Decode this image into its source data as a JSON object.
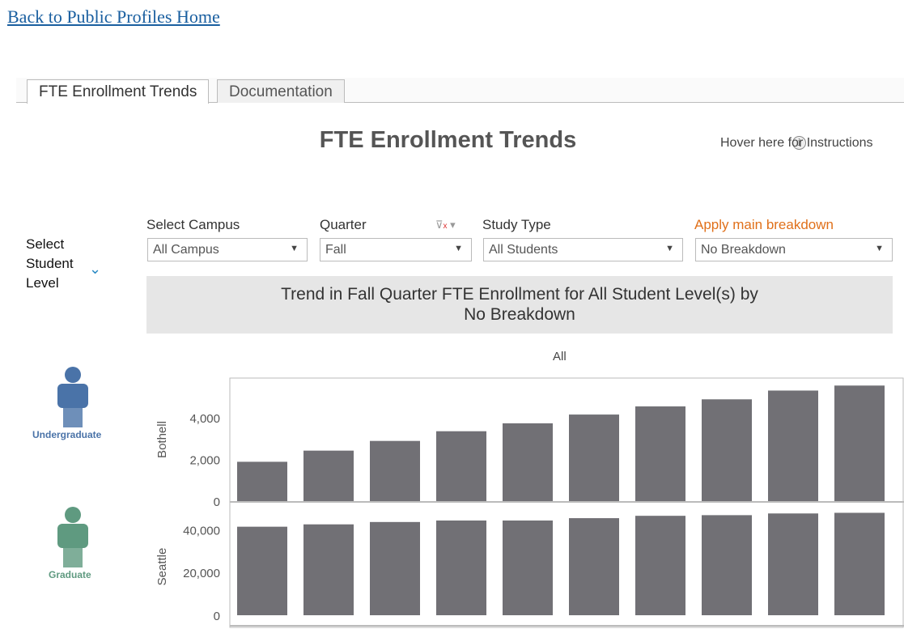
{
  "back_link": "Back to Public Profiles Home",
  "tabs": [
    {
      "label": "FTE Enrollment Trends",
      "active": true
    },
    {
      "label": "Documentation",
      "active": false
    }
  ],
  "title": "FTE Enrollment Trends",
  "instructions": "Hover here for Instructions",
  "student_level": {
    "label": "Select Student Level",
    "options": [
      {
        "label": "Undergraduate",
        "color": "#4a73a8"
      },
      {
        "label": "Graduate",
        "color": "#5f9a80"
      }
    ]
  },
  "filters": {
    "campus": {
      "label": "Select Campus",
      "value": "All Campus"
    },
    "quarter": {
      "label": "Quarter",
      "value": "Fall"
    },
    "study_type": {
      "label": "Study Type",
      "value": "All Students"
    },
    "breakdown": {
      "label": "Apply main breakdown",
      "value": "No Breakdown",
      "label_color": "#e0701a"
    }
  },
  "banner": {
    "line1": "Trend in Fall Quarter FTE Enrollment for All Student Level(s) by",
    "line2": "No Breakdown"
  },
  "chart_data": {
    "type": "bar",
    "column_header": "All",
    "bar_color": "#717075",
    "panes": [
      {
        "name": "Bothell",
        "ticks": [
          "0",
          "2,000",
          "4,000"
        ],
        "tick_values": [
          0,
          2000,
          4000
        ],
        "ylim": [
          0,
          5900
        ],
        "values": [
          1885,
          2420,
          2885,
          3350,
          3730,
          4150,
          4540,
          4880,
          5300,
          5540
        ]
      },
      {
        "name": "Seattle",
        "ticks": [
          "0",
          "20,000",
          "40,000"
        ],
        "tick_values": [
          0,
          20000,
          40000
        ],
        "ylim": [
          0,
          53000
        ],
        "values": [
          41400,
          42500,
          43600,
          44300,
          44300,
          45400,
          46500,
          46800,
          47600,
          47900
        ]
      }
    ]
  }
}
